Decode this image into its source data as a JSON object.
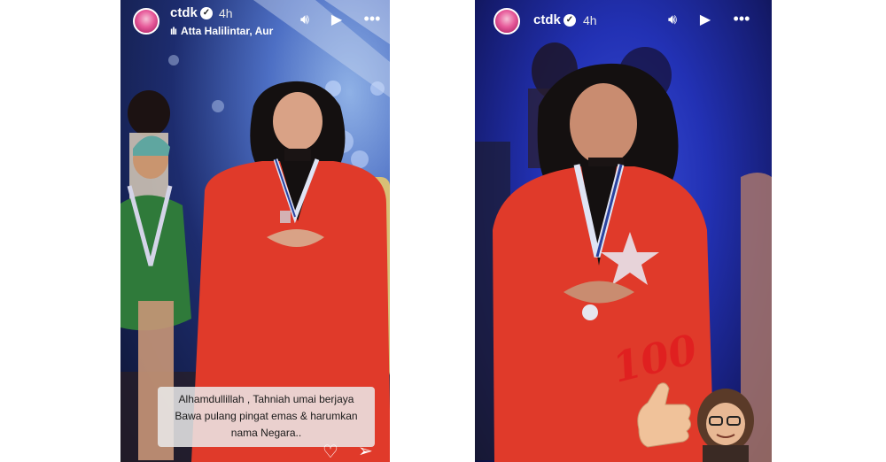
{
  "stories": [
    {
      "username": "ctdk",
      "time": "4h",
      "music": "Atta Halilintar, Aur",
      "caption_lines": [
        "Alhamdullillah , Tahniah umai berjaya",
        "Bawa pulang pingat emas & harumkan",
        "nama Negara.."
      ]
    },
    {
      "username": "ctdk",
      "time": "4h",
      "sticker_text": "100"
    }
  ],
  "icons": {
    "verified": "verified-badge-icon",
    "sound": "speaker-icon",
    "play": "play-icon",
    "more": "more-dots-icon",
    "like": "heart-icon",
    "share": "send-icon"
  },
  "colors": {
    "left_bg": "#1d2c6e",
    "right_bg": "#2231b4",
    "suit_red": "#e03a2a",
    "sticker_red": "#e02020"
  }
}
